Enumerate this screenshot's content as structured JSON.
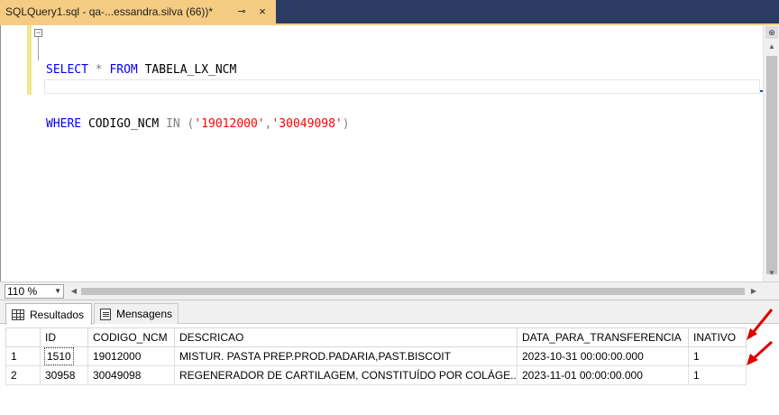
{
  "tab": {
    "title": "SQLQuery1.sql - qa-...essandra.silva (66))*",
    "pin_glyph": "⊸",
    "close_glyph": "×"
  },
  "editor": {
    "line1": {
      "kw1": "SELECT",
      "op": " * ",
      "kw2": "FROM",
      "rest": " TABELA_LX_NCM"
    },
    "line2": {
      "kw1": "WHERE",
      "mid": " CODIGO_NCM ",
      "kw2": "IN",
      "open": " (",
      "s1": "'19012000'",
      "comma": ",",
      "s2": "'30049098'",
      "close": ")"
    }
  },
  "zoom": {
    "value": "110 %"
  },
  "results": {
    "tabs": [
      {
        "label": "Resultados"
      },
      {
        "label": "Mensagens"
      }
    ],
    "columns": [
      "",
      "ID",
      "CODIGO_NCM",
      "DESCRICAO",
      "DATA_PARA_TRANSFERENCIA",
      "INATIVO"
    ],
    "rows": [
      [
        "1",
        "1510",
        "19012000",
        "MISTUR. PASTA PREP.PROD.PADARIA,PAST.BISCOIT",
        "2023-10-31 00:00:00.000",
        "1"
      ],
      [
        "2",
        "30958",
        "30049098",
        "REGENERADOR DE CARTILAGEM, CONSTITUÍDO POR COLÁGE...",
        "2023-11-01 00:00:00.000",
        "1"
      ]
    ]
  },
  "colors": {
    "tab_bg": "#f5cc84",
    "titlebar_bg": "#2b3b63",
    "keyword": "#0000ff",
    "string": "#ff0000",
    "annotation_arrow": "#e00000"
  }
}
